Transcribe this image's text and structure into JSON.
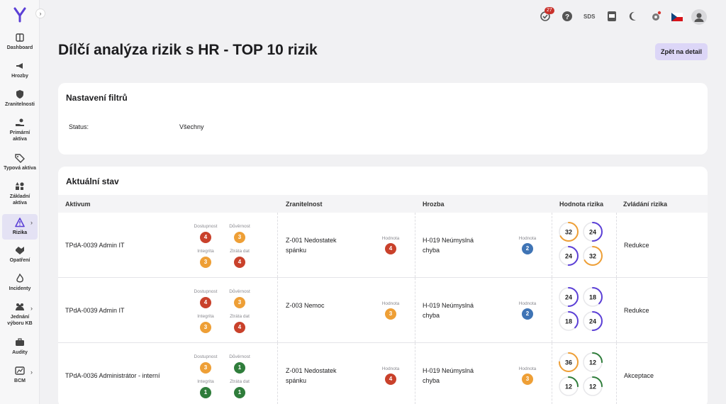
{
  "colors": {
    "high": "#c9412b",
    "medium": "#ee9f36",
    "low": "#2f7d3b",
    "blue": "#3f74b5",
    "accent": "#5b3fd6"
  },
  "topbar": {
    "notif_count": "27",
    "sds_label": "SDS"
  },
  "sidebar": {
    "items": [
      {
        "label": "Dashboard",
        "icon": "dashboard-icon"
      },
      {
        "label": "Hrozby",
        "icon": "megaphone-icon"
      },
      {
        "label": "Zranitelnosti",
        "icon": "shield-icon"
      },
      {
        "label": "Primární\naktiva",
        "icon": "hand-coin-icon"
      },
      {
        "label": "Typová aktiva",
        "icon": "tag-icon"
      },
      {
        "label": "Základní\naktiva",
        "icon": "shapes-icon"
      },
      {
        "label": "Rizika",
        "icon": "warning-icon"
      },
      {
        "label": "Opatření",
        "icon": "handshake-icon"
      },
      {
        "label": "Incidenty",
        "icon": "flame-icon"
      },
      {
        "label": "Jednání\nvýboru KB",
        "icon": "group-icon"
      },
      {
        "label": "Audity",
        "icon": "briefcase-icon"
      },
      {
        "label": "BCM",
        "icon": "chart-icon"
      }
    ]
  },
  "page": {
    "title": "Dílčí analýza rizik s HR - TOP 10 rizik",
    "back_label": "Zpět na detail"
  },
  "filters": {
    "title": "Nastavení filtrů",
    "status_label": "Status:",
    "status_value": "Všechny"
  },
  "current": {
    "title": "Aktuální stav",
    "headers": [
      "Aktivum",
      "Zranitelnost",
      "Hrozba",
      "Hodnota rizika",
      "Zvládání rizika"
    ],
    "cia_labels": {
      "d": "Dostupnost",
      "c": "Důvěrnost",
      "i": "Integrita",
      "z": "Ztráta dat"
    },
    "value_label": "Hodnota",
    "rows": [
      {
        "asset": "TPdA-0039 Admin IT",
        "cia": {
          "d": "4",
          "c": "3",
          "i": "3",
          "z": "4"
        },
        "vuln": "Z-001 Nedostatek\nspánku",
        "vuln_val": "4",
        "threat": "H-019 Neúmyslná\nchyba",
        "threat_val": "2",
        "risk": [
          "32",
          "24",
          "24",
          "32"
        ],
        "treat": "Redukce"
      },
      {
        "asset": "TPdA-0039 Admin IT",
        "cia": {
          "d": "4",
          "c": "3",
          "i": "3",
          "z": "4"
        },
        "vuln": "Z-003 Nemoc",
        "vuln_val": "3",
        "threat": "H-019 Neúmyslná\nchyba",
        "threat_val": "2",
        "risk": [
          "24",
          "18",
          "18",
          "24"
        ],
        "treat": "Redukce"
      },
      {
        "asset": "TPdA-0036 Administrátor - interní",
        "cia": {
          "d": "3",
          "c": "1",
          "i": "1",
          "z": "1"
        },
        "vuln": "Z-001 Nedostatek\nspánku",
        "vuln_val": "4",
        "threat": "H-019 Neúmyslná\nchyba",
        "threat_val": "3",
        "risk": [
          "36",
          "12",
          "12",
          "12"
        ],
        "treat": "Akceptace"
      }
    ]
  }
}
